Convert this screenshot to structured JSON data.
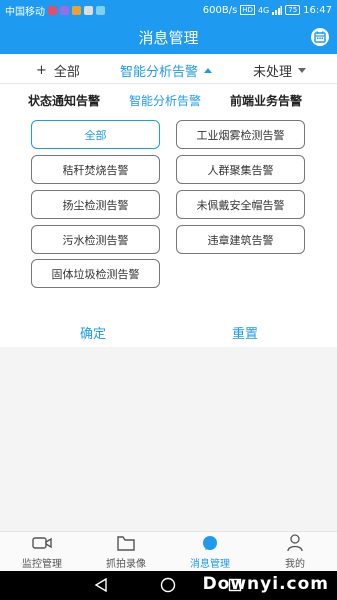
{
  "status_bar": {
    "carrier": "中国移动",
    "speed": "600B/s",
    "network": "4G",
    "battery": "75",
    "time": "16:47"
  },
  "header": {
    "title": "消息管理"
  },
  "filters": {
    "all_prefix": "+",
    "all_label": "全部",
    "smart_label": "智能分析告警",
    "status_label": "未处理"
  },
  "category_tabs": [
    "状态通知告警",
    "智能分析告警",
    "前端业务告警"
  ],
  "options": [
    "全部",
    "工业烟雾检测告警",
    "秸秆焚烧告警",
    "人群聚集告警",
    "扬尘检测告警",
    "未佩戴安全帽告警",
    "污水检测告警",
    "违章建筑告警",
    "固体垃圾检测告警"
  ],
  "selected_option": "全部",
  "actions": {
    "confirm": "确定",
    "reset": "重置"
  },
  "tabbar": {
    "items": [
      "监控管理",
      "抓拍录像",
      "消息管理",
      "我的"
    ],
    "active": "消息管理"
  },
  "watermark": "Downyi.com",
  "colors": {
    "accent": "#1e9bf0",
    "border": "#777777",
    "panel_gray": "#f4f4f4"
  }
}
